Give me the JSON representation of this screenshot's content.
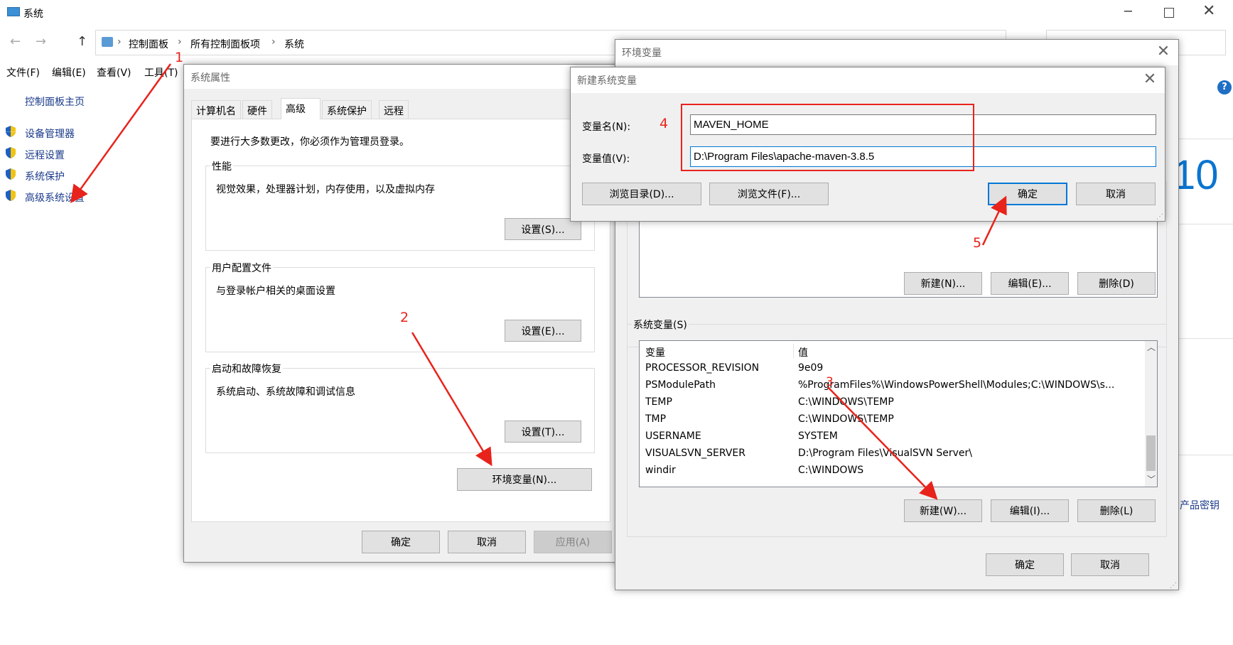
{
  "window": {
    "title": "系统"
  },
  "nav": {
    "back": "←",
    "forward": "→",
    "up": "↑",
    "breadcrumb": [
      "控制面板",
      "所有控制面板项",
      "系统"
    ]
  },
  "menu": [
    "文件(F)",
    "编辑(E)",
    "查看(V)",
    "工具(T)"
  ],
  "sidebar": {
    "home": "控制面板主页",
    "items": [
      "设备管理器",
      "远程设置",
      "系统保护",
      "高级系统设置"
    ]
  },
  "sysprops": {
    "title": "系统属性",
    "tabs": [
      "计算机名",
      "硬件",
      "高级",
      "系统保护",
      "远程"
    ],
    "notice": "要进行大多数更改，你必须作为管理员登录。",
    "perf": {
      "title": "性能",
      "desc": "视觉效果，处理器计划，内存使用，以及虚拟内存",
      "btn": "设置(S)..."
    },
    "profile": {
      "title": "用户配置文件",
      "desc": "与登录帐户相关的桌面设置",
      "btn": "设置(E)..."
    },
    "startup": {
      "title": "启动和故障恢复",
      "desc": "系统启动、系统故障和调试信息",
      "btn": "设置(T)..."
    },
    "env_btn": "环境变量(N)...",
    "ok": "确定",
    "cancel": "取消",
    "apply": "应用(A)"
  },
  "envvars": {
    "title": "环境变量",
    "user_buttons": {
      "new": "新建(N)...",
      "edit": "编辑(E)...",
      "delete": "删除(D)"
    },
    "sys_title": "系统变量(S)",
    "col_var": "变量",
    "col_val": "值",
    "rows": [
      {
        "name": "PROCESSOR_REVISION",
        "value": "9e09"
      },
      {
        "name": "PSModulePath",
        "value": "%ProgramFiles%\\WindowsPowerShell\\Modules;C:\\WINDOWS\\s..."
      },
      {
        "name": "TEMP",
        "value": "C:\\WINDOWS\\TEMP"
      },
      {
        "name": "TMP",
        "value": "C:\\WINDOWS\\TEMP"
      },
      {
        "name": "USERNAME",
        "value": "SYSTEM"
      },
      {
        "name": "VISUALSVN_SERVER",
        "value": "D:\\Program Files\\VisualSVN Server\\"
      },
      {
        "name": "windir",
        "value": "C:\\WINDOWS"
      }
    ],
    "sys_buttons": {
      "new": "新建(W)...",
      "edit": "编辑(I)...",
      "delete": "删除(L)"
    },
    "ok": "确定",
    "cancel": "取消"
  },
  "newvar": {
    "title": "新建系统变量",
    "name_label": "变量名(N):",
    "value_label": "变量值(V):",
    "name_value": "MAVEN_HOME",
    "value_value": "D:\\Program Files\\apache-maven-3.8.5",
    "browse_dir": "浏览目录(D)...",
    "browse_file": "浏览文件(F)...",
    "ok": "确定",
    "cancel": "取消"
  },
  "background": {
    "win10_text": "10",
    "product_key_text": "产品密钥",
    "help": "?"
  },
  "annotations": [
    "1",
    "2",
    "3",
    "4",
    "5"
  ],
  "colors": {
    "annotation": "#e8231b",
    "accent": "#0078d7"
  }
}
